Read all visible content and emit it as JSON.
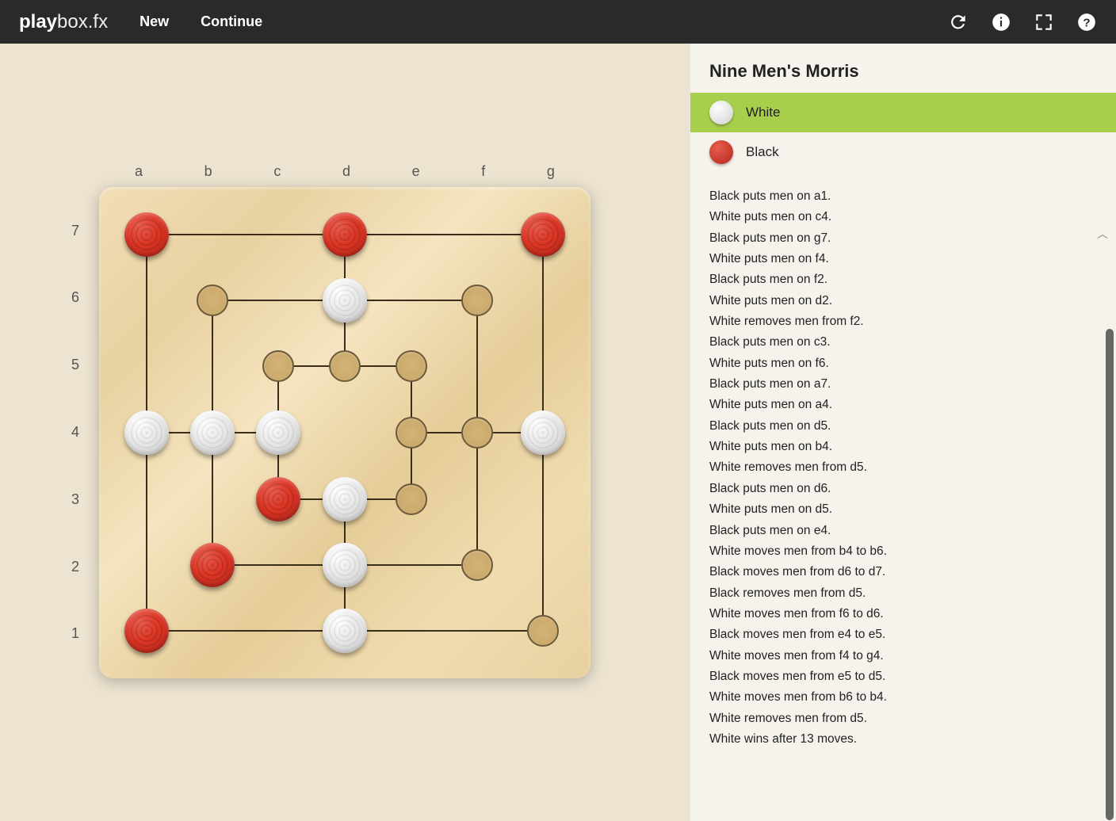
{
  "brand": {
    "play": "play",
    "box": "box",
    "fx": ".fx"
  },
  "header": {
    "new": "New",
    "continue": "Continue"
  },
  "game": {
    "title": "Nine Men's Morris",
    "player_white": "White",
    "player_black": "Black",
    "active": "white"
  },
  "board": {
    "cols": [
      "a",
      "b",
      "c",
      "d",
      "e",
      "f",
      "g"
    ],
    "rows": [
      "7",
      "6",
      "5",
      "4",
      "3",
      "2",
      "1"
    ],
    "positions": [
      {
        "file": "a",
        "rank": 7,
        "state": "red"
      },
      {
        "file": "d",
        "rank": 7,
        "state": "red"
      },
      {
        "file": "g",
        "rank": 7,
        "state": "red"
      },
      {
        "file": "b",
        "rank": 6,
        "state": "empty"
      },
      {
        "file": "d",
        "rank": 6,
        "state": "white"
      },
      {
        "file": "f",
        "rank": 6,
        "state": "empty"
      },
      {
        "file": "c",
        "rank": 5,
        "state": "empty"
      },
      {
        "file": "d",
        "rank": 5,
        "state": "empty"
      },
      {
        "file": "e",
        "rank": 5,
        "state": "empty"
      },
      {
        "file": "a",
        "rank": 4,
        "state": "white"
      },
      {
        "file": "b",
        "rank": 4,
        "state": "white"
      },
      {
        "file": "c",
        "rank": 4,
        "state": "white"
      },
      {
        "file": "e",
        "rank": 4,
        "state": "empty"
      },
      {
        "file": "f",
        "rank": 4,
        "state": "empty"
      },
      {
        "file": "g",
        "rank": 4,
        "state": "white"
      },
      {
        "file": "c",
        "rank": 3,
        "state": "red"
      },
      {
        "file": "d",
        "rank": 3,
        "state": "white"
      },
      {
        "file": "e",
        "rank": 3,
        "state": "empty"
      },
      {
        "file": "b",
        "rank": 2,
        "state": "red"
      },
      {
        "file": "d",
        "rank": 2,
        "state": "white"
      },
      {
        "file": "f",
        "rank": 2,
        "state": "empty"
      },
      {
        "file": "a",
        "rank": 1,
        "state": "red"
      },
      {
        "file": "d",
        "rank": 1,
        "state": "white"
      },
      {
        "file": "g",
        "rank": 1,
        "state": "empty"
      }
    ]
  },
  "moves": [
    "Black puts men on a1.",
    "White puts men on c4.",
    "Black puts men on g7.",
    "White puts men on f4.",
    "Black puts men on f2.",
    "White puts men on d2.",
    "White removes men from f2.",
    "Black puts men on c3.",
    "White puts men on f6.",
    "Black puts men on a7.",
    "White puts men on a4.",
    "Black puts men on d5.",
    "White puts men on b4.",
    "White removes men from d5.",
    "Black puts men on d6.",
    "White puts men on d5.",
    "Black puts men on e4.",
    "White moves men from b4 to b6.",
    "Black moves men from d6 to d7.",
    "Black removes men from d5.",
    "White moves men from f6 to d6.",
    "Black moves men from e4 to e5.",
    "White moves men from f4 to g4.",
    "Black moves men from e5 to d5.",
    "White moves men from b6 to b4.",
    "White removes men from d5.",
    "White wins after 13 moves."
  ]
}
